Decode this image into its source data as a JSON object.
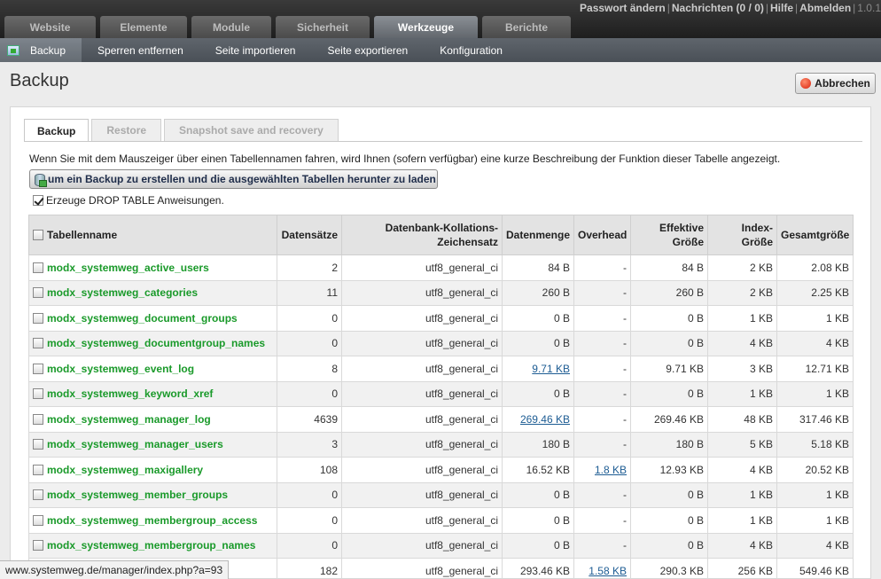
{
  "topnav": {
    "tabs": [
      {
        "label": "Website",
        "active": false
      },
      {
        "label": "Elemente",
        "active": false
      },
      {
        "label": "Module",
        "active": false
      },
      {
        "label": "Sicherheit",
        "active": false
      },
      {
        "label": "Werkzeuge",
        "active": true
      },
      {
        "label": "Berichte",
        "active": false
      }
    ],
    "user_links": [
      "Passwort ändern",
      "Nachrichten (0 / 0)",
      "Hilfe",
      "Abmelden"
    ],
    "version": "1.0.1"
  },
  "subnav": {
    "items": [
      "Backup",
      "Sperren entfernen",
      "Seite importieren",
      "Seite exportieren",
      "Konfiguration"
    ],
    "active": "Backup"
  },
  "page": {
    "title": "Backup",
    "cancel_label": "Abbrechen"
  },
  "panel": {
    "tabs": [
      {
        "label": "Backup",
        "active": true
      },
      {
        "label": "Restore",
        "active": false
      },
      {
        "label": "Snapshot save and recovery",
        "active": false
      }
    ],
    "description": "Wenn Sie mit dem Mauszeiger über einen Tabellennamen fahren, wird Ihnen (sofern verfügbar) eine kurze Beschreibung der Funktion dieser Tabelle angezeigt.",
    "backup_button": "um ein Backup zu erstellen und die ausgewählten Tabellen herunter zu laden",
    "drop_table_label": "Erzeuge DROP TABLE Anweisungen.",
    "drop_table_checked": true
  },
  "table": {
    "headers": {
      "name": "Tabellenname",
      "records": "Datensätze",
      "collation_line1": "Datenbank-Kollations-",
      "collation_line2": "Zeichensatz",
      "size": "Datenmenge",
      "overhead": "Overhead",
      "effective_line1": "Effektive",
      "effective_line2": "Größe",
      "index": "Index-Größe",
      "total": "Gesamtgröße"
    },
    "rows": [
      {
        "name": "modx_systemweg_active_users",
        "records": "2",
        "collation": "utf8_general_ci",
        "size": "84 B",
        "size_link": false,
        "overhead": "-",
        "overhead_link": false,
        "effective": "84 B",
        "index": "2 KB",
        "total": "2.08 KB"
      },
      {
        "name": "modx_systemweg_categories",
        "records": "11",
        "collation": "utf8_general_ci",
        "size": "260 B",
        "size_link": false,
        "overhead": "-",
        "overhead_link": false,
        "effective": "260 B",
        "index": "2 KB",
        "total": "2.25 KB"
      },
      {
        "name": "modx_systemweg_document_groups",
        "records": "0",
        "collation": "utf8_general_ci",
        "size": "0 B",
        "size_link": false,
        "overhead": "-",
        "overhead_link": false,
        "effective": "0 B",
        "index": "1 KB",
        "total": "1 KB"
      },
      {
        "name": "modx_systemweg_documentgroup_names",
        "records": "0",
        "collation": "utf8_general_ci",
        "size": "0 B",
        "size_link": false,
        "overhead": "-",
        "overhead_link": false,
        "effective": "0 B",
        "index": "4 KB",
        "total": "4 KB"
      },
      {
        "name": "modx_systemweg_event_log",
        "records": "8",
        "collation": "utf8_general_ci",
        "size": "9.71 KB",
        "size_link": true,
        "overhead": "-",
        "overhead_link": false,
        "effective": "9.71 KB",
        "index": "3 KB",
        "total": "12.71 KB"
      },
      {
        "name": "modx_systemweg_keyword_xref",
        "records": "0",
        "collation": "utf8_general_ci",
        "size": "0 B",
        "size_link": false,
        "overhead": "-",
        "overhead_link": false,
        "effective": "0 B",
        "index": "1 KB",
        "total": "1 KB"
      },
      {
        "name": "modx_systemweg_manager_log",
        "records": "4639",
        "collation": "utf8_general_ci",
        "size": "269.46 KB",
        "size_link": true,
        "overhead": "-",
        "overhead_link": false,
        "effective": "269.46 KB",
        "index": "48 KB",
        "total": "317.46 KB"
      },
      {
        "name": "modx_systemweg_manager_users",
        "records": "3",
        "collation": "utf8_general_ci",
        "size": "180 B",
        "size_link": false,
        "overhead": "-",
        "overhead_link": false,
        "effective": "180 B",
        "index": "5 KB",
        "total": "5.18 KB"
      },
      {
        "name": "modx_systemweg_maxigallery",
        "records": "108",
        "collation": "utf8_general_ci",
        "size": "16.52 KB",
        "size_link": false,
        "overhead": "1.8 KB",
        "overhead_link": true,
        "effective": "12.93 KB",
        "index": "4 KB",
        "total": "20.52 KB"
      },
      {
        "name": "modx_systemweg_member_groups",
        "records": "0",
        "collation": "utf8_general_ci",
        "size": "0 B",
        "size_link": false,
        "overhead": "-",
        "overhead_link": false,
        "effective": "0 B",
        "index": "1 KB",
        "total": "1 KB"
      },
      {
        "name": "modx_systemweg_membergroup_access",
        "records": "0",
        "collation": "utf8_general_ci",
        "size": "0 B",
        "size_link": false,
        "overhead": "-",
        "overhead_link": false,
        "effective": "0 B",
        "index": "1 KB",
        "total": "1 KB"
      },
      {
        "name": "modx_systemweg_membergroup_names",
        "records": "0",
        "collation": "utf8_general_ci",
        "size": "0 B",
        "size_link": false,
        "overhead": "-",
        "overhead_link": false,
        "effective": "0 B",
        "index": "4 KB",
        "total": "4 KB"
      },
      {
        "name": "",
        "records": "182",
        "collation": "utf8_general_ci",
        "size": "293.46 KB",
        "size_link": false,
        "overhead": "1.58 KB",
        "overhead_link": true,
        "effective": "290.3 KB",
        "index": "256 KB",
        "total": "549.46 KB"
      }
    ]
  },
  "statusbar": {
    "url": "www.systemweg.de/manager/index.php?a=93"
  },
  "colors": {
    "table_name_green": "#1a9a2a",
    "link_blue": "#1d5c93",
    "active_tab": "#62676d"
  }
}
